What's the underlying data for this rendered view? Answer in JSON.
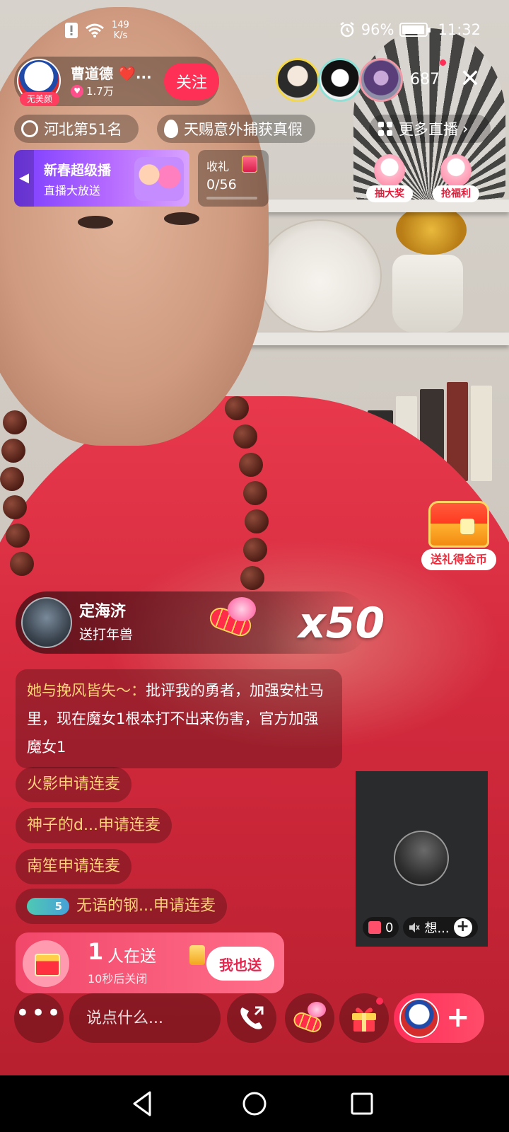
{
  "status_bar": {
    "net_speed_value": "149",
    "net_speed_unit": "K/s",
    "battery_percent": "96%",
    "battery_level": 0.96,
    "time": "11:32"
  },
  "host": {
    "name": "曹道德 ❤️...",
    "avatar_tag": "无美颜",
    "fans": "1.7万",
    "follow_label": "关注"
  },
  "viewers": {
    "count": "687"
  },
  "rank_row": {
    "rank_label": "河北第51名",
    "scroll_text": "天赐意外捕获真假",
    "more_live_label": "更多直播"
  },
  "banner": {
    "title": "新春超级播",
    "subtitle": "直播大放送"
  },
  "gift_progress": {
    "label": "收礼",
    "value": "0/56",
    "progress": 0.0
  },
  "actions": {
    "lottery_label": "抽大奖",
    "welfare_label": "抢福利",
    "treasure_label": "送礼得金币"
  },
  "gift_combo": {
    "user": "定海济",
    "description": "送打年兽",
    "multiplier": "x50"
  },
  "chat": {
    "message": {
      "user": "她与挽风皆失～：",
      "text": "批评我的勇者，加强安杜马里，现在魔女1根本打不出来伤害，官方加强魔女1"
    },
    "requests": [
      {
        "text": "火影申请连麦"
      },
      {
        "text": "神子的d...申请连麦"
      },
      {
        "text": "南笙申请连麦"
      },
      {
        "badge": "5",
        "text": "无语的钢...申请连麦"
      }
    ]
  },
  "costream": {
    "gift_count": "0",
    "name": "想..."
  },
  "sending": {
    "count": "1",
    "text": "人在送",
    "timer": "10秒后关闭",
    "button_label": "我也送"
  },
  "bottom_bar": {
    "input_placeholder": "说点什么..."
  },
  "colors": {
    "accent": "#ff3056",
    "chat_user": "#ffd27a",
    "banner": "#7a3cff"
  },
  "icons": {
    "status": [
      "exclamation-icon",
      "wifi-icon",
      "alarm-icon",
      "battery-icon"
    ],
    "bottom": [
      "more-icon",
      "call-icon",
      "dragon-gift-icon",
      "gift-icon",
      "plus-icon"
    ],
    "nav": [
      "back-icon",
      "home-icon",
      "recents-icon"
    ]
  }
}
